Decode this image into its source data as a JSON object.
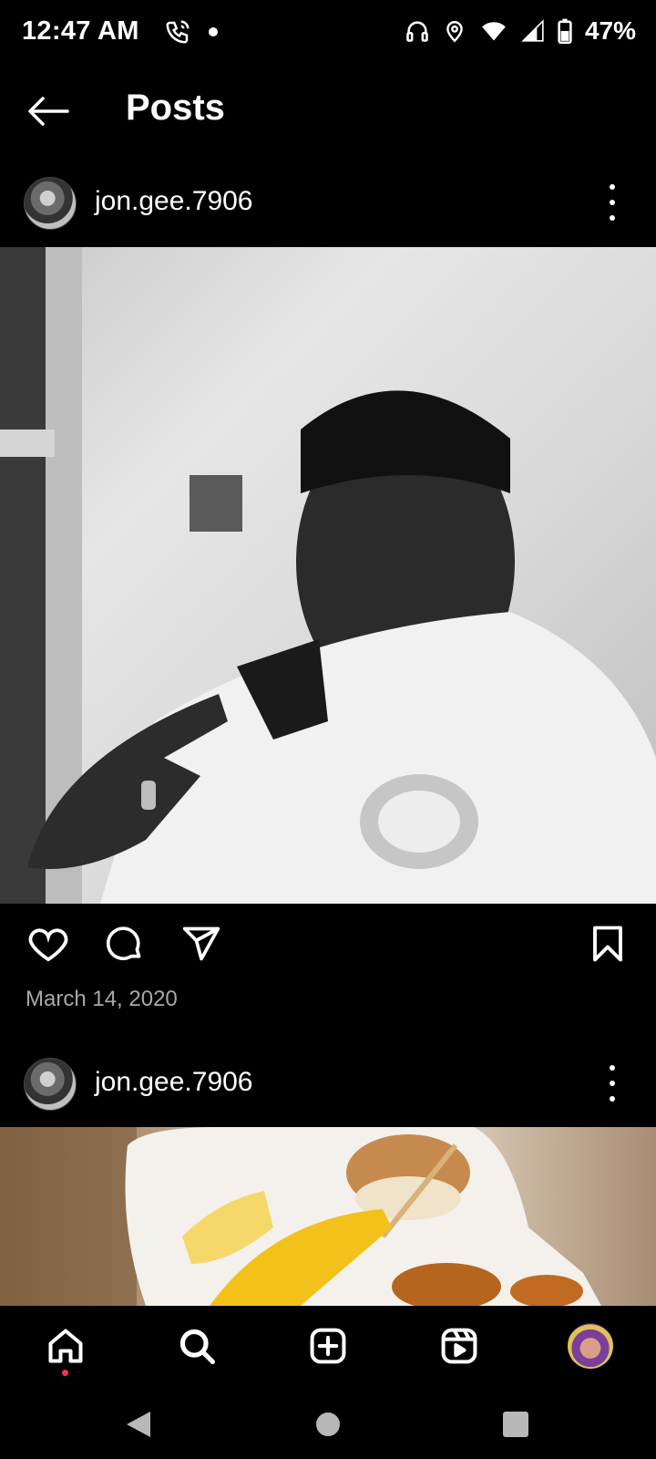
{
  "status_bar": {
    "time": "12:47 AM",
    "battery": "47%",
    "icons": [
      "wifi-calling-icon",
      "notification-dot-icon",
      "headphones-icon",
      "location-icon",
      "wifi-icon",
      "signal-icon",
      "battery-icon"
    ]
  },
  "header": {
    "title": "Posts",
    "back_icon": "arrow-left-icon"
  },
  "posts": [
    {
      "username": "jon.gee.7906",
      "date": "March 14, 2020",
      "image_description": "grayscale selfie photo"
    },
    {
      "username": "jon.gee.7906",
      "image_description": "food photo with corn on the cob"
    }
  ],
  "actions": {
    "like_icon": "heart-icon",
    "comment_icon": "comment-icon",
    "share_icon": "send-icon",
    "save_icon": "bookmark-icon"
  },
  "bottom_nav": {
    "items": [
      "home-icon",
      "search-icon",
      "create-icon",
      "reels-icon",
      "profile-avatar"
    ],
    "active": "home"
  },
  "colors": {
    "background": "#000000",
    "text": "#ffffff",
    "secondary_text": "#a8a8a8",
    "notification_dot": "#ff2d55"
  }
}
